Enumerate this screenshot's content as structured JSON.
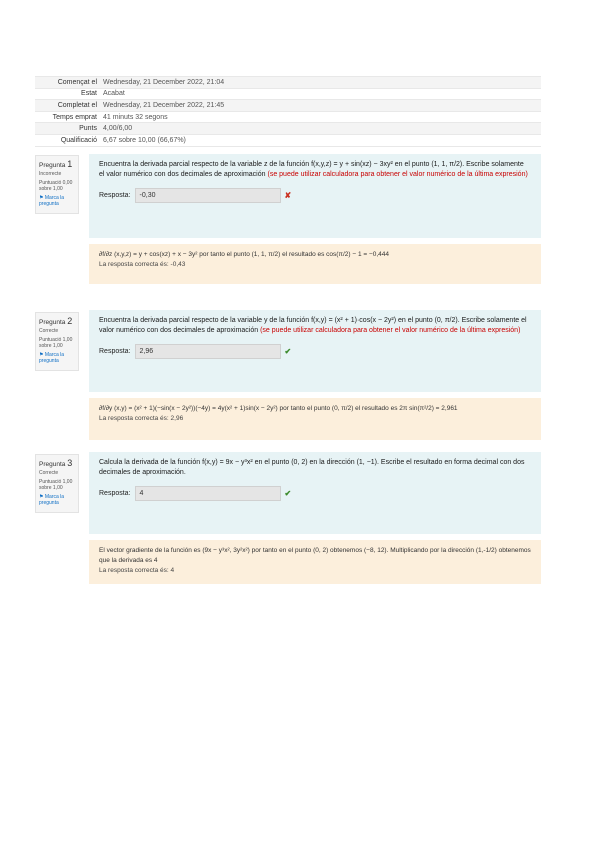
{
  "summary": [
    {
      "label": "Començat el",
      "value": "Wednesday, 21 December 2022, 21:04"
    },
    {
      "label": "Estat",
      "value": "Acabat"
    },
    {
      "label": "Completat el",
      "value": "Wednesday, 21 December 2022, 21:45"
    },
    {
      "label": "Temps emprat",
      "value": "41 minuts 32 segons"
    },
    {
      "label": "Punts",
      "value": "4,00/6,00"
    },
    {
      "label": "Qualificació",
      "value": "6,67 sobre 10,00 (66,67%)"
    }
  ],
  "questions": [
    {
      "label": "Pregunta",
      "number": "1",
      "state": "Incorrecte",
      "grade": "Puntuació 0,00 sobre 1,00",
      "flag": "Marca la pregunta",
      "text": "Encuentra la derivada parcial respecto de la variable z de la función f(x,y,z) = y + sin(xz) − 3xy² en el punto (1, 1, π/2). Escribe solamente el valor numérico con dos decimales de aproximación ",
      "text_red": "(se puede utilizar calculadora para obtener el valor numérico de la última expresión)",
      "answer_label": "Resposta:",
      "answer": "-0,30",
      "mark": "✘",
      "feedback": "∂f/∂z (x,y,z) = y + cos(xz) + x − 3y² por tanto el punto (1, 1, π/2) el resultado es cos(π/2) − 1 = −0,444",
      "correct": "La resposta correcta és: -0,43"
    },
    {
      "label": "Pregunta",
      "number": "2",
      "state": "Correcte",
      "grade": "Puntuació 1,00 sobre 1,00",
      "flag": "Marca la pregunta",
      "text": "Encuentra la derivada parcial respecto de la variable y de la función f(x,y) = (x² + 1)·cos(x − 2y²) en el punto (0, π/2). Escribe solamente el valor numérico con dos decimales de aproximación ",
      "text_red": "(se puede utilizar calculadora para obtener el valor numérico de la última expresión)",
      "answer_label": "Resposta:",
      "answer": "2,96",
      "mark": "✔",
      "feedback": "∂f/∂y (x,y) = (x² + 1)(−sin(x − 2y²))(−4y) = 4y(x² + 1)sin(x − 2y²) por tanto el punto (0, π/2) el resultado es 2π sin(π²/2) = 2,961",
      "correct": "La resposta correcta és: 2,96"
    },
    {
      "label": "Pregunta",
      "number": "3",
      "state": "Correcte",
      "grade": "Puntuació 1,00 sobre 1,00",
      "flag": "Marca la pregunta",
      "text": "Calcula la derivada de la función f(x,y) = 9x − y³x² en el punto (0, 2) en la dirección (1, −1). Escribe el resultado en forma decimal con dos decimales de aproximación.",
      "text_red": "",
      "answer_label": "Resposta:",
      "answer": "4",
      "mark": "✔",
      "feedback": "El vector gradiente de la función es (9x − y³x², 3y²x²) por tanto en el punto (0, 2) obtenemos (−8, 12). Multiplicando por la dirección (1,-1/2) obtenemos que la derivada es 4",
      "correct": "La resposta correcta és: 4"
    }
  ]
}
